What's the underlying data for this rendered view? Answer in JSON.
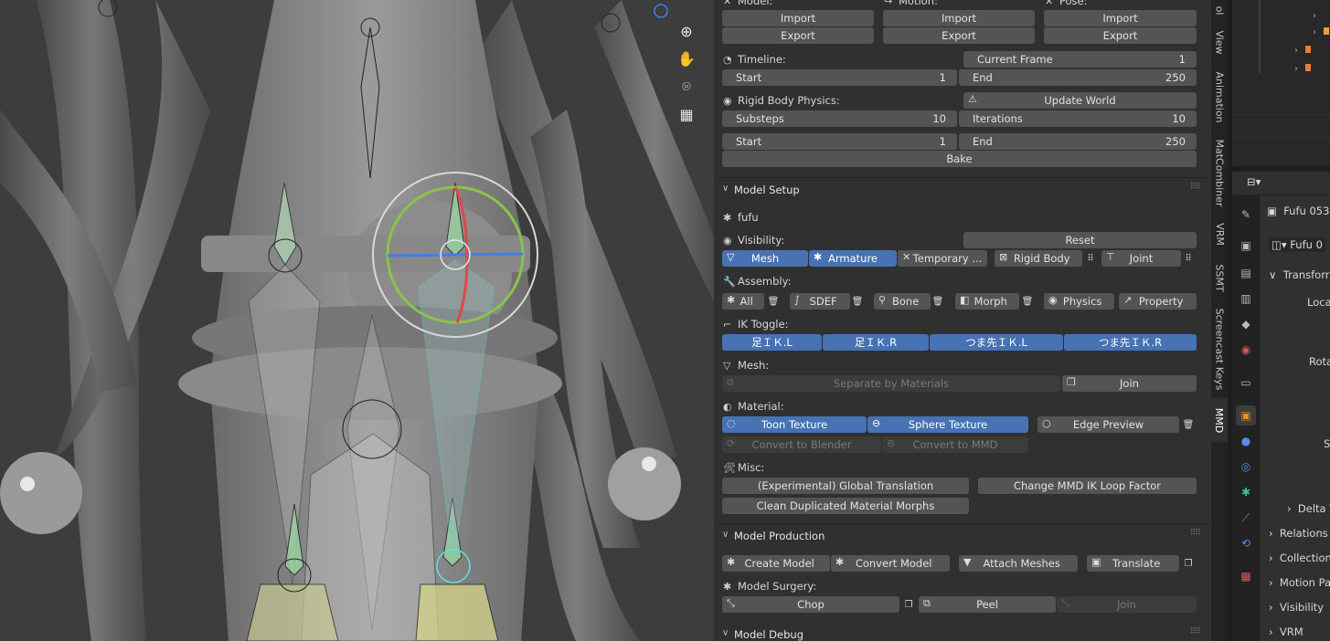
{
  "panel": {
    "top_row": {
      "model_label": "Model:",
      "motion_label": "Motion:",
      "pose_label": "Pose:",
      "import_label": "Import",
      "export_label": "Export"
    },
    "timeline": {
      "label": "Timeline:",
      "current_frame_label": "Current Frame",
      "current_frame_value": "1",
      "start_label": "Start",
      "start_value": "1",
      "end_label": "End",
      "end_value": "250"
    },
    "rigid": {
      "label": "Rigid Body Physics:",
      "update_world": "Update World",
      "substeps_label": "Substeps",
      "substeps_value": "10",
      "iterations_label": "Iterations",
      "iterations_value": "10",
      "start_label": "Start",
      "start_value": "1",
      "end_label": "End",
      "end_value": "250",
      "bake": "Bake"
    },
    "model_setup": {
      "title": "Model Setup",
      "model_name": "fufu",
      "visibility_label": "Visibility:",
      "reset": "Reset",
      "vis_buttons": [
        "Mesh",
        "Armature",
        "Temporary ...",
        "Rigid Body",
        "Joint"
      ],
      "assembly_label": "Assembly:",
      "assembly_buttons": [
        "All",
        "SDEF",
        "Bone",
        "Morph",
        "Physics",
        "Property"
      ],
      "ik_label": "IK Toggle:",
      "ik_buttons": [
        "足ＩＫ.L",
        "足ＩＫ.R",
        "つま先ＩＫ.L",
        "つま先ＩＫ.R"
      ],
      "mesh_label": "Mesh:",
      "separate": "Separate by Materials",
      "join": "Join",
      "material_label": "Material:",
      "toon": "Toon Texture",
      "sphere": "Sphere Texture",
      "edge_preview": "Edge Preview",
      "convert_blender": "Convert to Blender",
      "convert_mmd": "Convert to MMD",
      "misc_label": "Misc:",
      "global_translation": "(Experimental) Global Translation",
      "change_ik_loop": "Change MMD IK Loop Factor",
      "clean_morphs": "Clean Duplicated Material Morphs"
    },
    "model_production": {
      "title": "Model Production",
      "create_model": "Create Model",
      "convert_model": "Convert Model",
      "attach_meshes": "Attach Meshes",
      "translate": "Translate",
      "surgery_label": "Model Surgery:",
      "chop": "Chop",
      "peel": "Peel",
      "join": "Join"
    },
    "model_debug": {
      "title": "Model Debug"
    }
  },
  "vtabs": [
    "ol",
    "View",
    "Animation",
    "MatCombiner",
    "VRM",
    "SSMT",
    "Screencast Keys",
    "MMD"
  ],
  "properties": {
    "object_name": "Fufu 053",
    "object_field": "Fufu 0",
    "rows": [
      "Transforr",
      "Loca",
      "Rota",
      "S",
      "Delta T",
      "Relations",
      "Collection",
      "Motion Pa",
      "Visibility",
      "VRM"
    ]
  },
  "colors": {
    "accent_blue": "#4772b3",
    "panel_bg": "#303030",
    "button_bg": "#545454",
    "viewport_bg": "#3d3d3d"
  }
}
